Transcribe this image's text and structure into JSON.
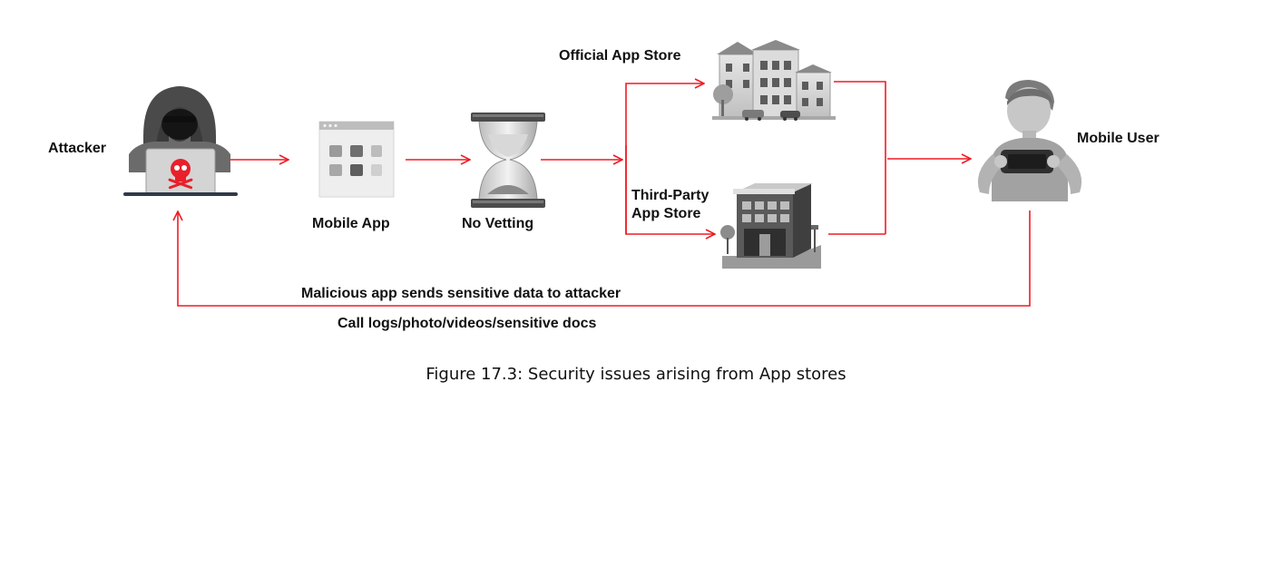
{
  "colors": {
    "arrow": "#ee1c25",
    "icon_dark": "#4a4a4a",
    "icon_mid": "#8c8c8c",
    "icon_light": "#cfcfcf",
    "skull": "#e8202a"
  },
  "nodes": {
    "attacker": {
      "label": "Attacker",
      "icon": "hacker-icon"
    },
    "mobile_app": {
      "label": "Mobile App",
      "icon": "app-window-icon"
    },
    "no_vetting": {
      "label": "No Vetting",
      "icon": "hourglass-icon"
    },
    "official_store": {
      "label": "Official App Store",
      "icon": "city-buildings-icon"
    },
    "third_party_store": {
      "label_line1": "Third-Party",
      "label_line2": "App Store",
      "icon": "shop-building-icon"
    },
    "mobile_user": {
      "label": "Mobile User",
      "icon": "user-with-phone-icon"
    }
  },
  "return_flow": {
    "line1": "Malicious app sends sensitive data to attacker",
    "line2": "Call logs/photo/videos/sensitive docs"
  },
  "caption": "Figure 17.3: Security issues arising from App stores"
}
